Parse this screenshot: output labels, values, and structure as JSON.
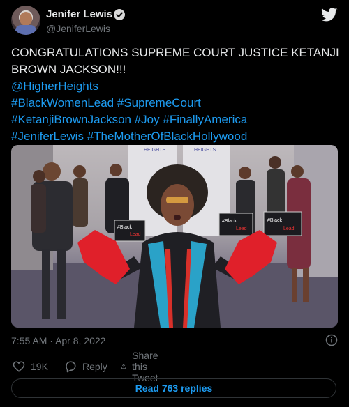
{
  "author": {
    "display_name": "Jenifer Lewis",
    "handle": "@JeniferLewis",
    "verified": true
  },
  "tweet": {
    "lines": [
      [
        {
          "text": "CONGRATULATIONS SUPREME COURT JUSTICE KETANJI",
          "link": false
        }
      ],
      [
        {
          "text": "BROWN JACKSON!!!",
          "link": false
        }
      ],
      [
        {
          "text": "@HigherHeights",
          "link": true
        }
      ],
      [
        {
          "text": "#BlackWomenLead",
          "link": true
        },
        {
          "text": " ",
          "link": false
        },
        {
          "text": "#SupremeCourt",
          "link": true
        }
      ],
      [
        {
          "text": "#KetanjiBrownJackson",
          "link": true
        },
        {
          "text": " ",
          "link": false
        },
        {
          "text": "#Joy",
          "link": true
        },
        {
          "text": " ",
          "link": false
        },
        {
          "text": "#FinallyAmerica",
          "link": true
        }
      ],
      [
        {
          "text": "#JeniferLewis",
          "link": true
        },
        {
          "text": " ",
          "link": false
        },
        {
          "text": "#TheMotherOfBlackHollywood",
          "link": true
        }
      ]
    ]
  },
  "media": {
    "backdrop_text": "HEIGHTS",
    "signs": [
      {
        "line1": "#Black",
        "line2": "Lead"
      },
      {
        "line1": "#Black",
        "line2": "Lead"
      },
      {
        "line1": "#Black",
        "line2": "Lead"
      }
    ]
  },
  "meta": {
    "time": "7:55 AM",
    "separator": "·",
    "date": "Apr 8, 2022"
  },
  "actions": {
    "like_count": "19K",
    "reply_label": "Reply",
    "share_label": "Share this Tweet"
  },
  "read_replies_label": "Read 763 replies",
  "colors": {
    "accent": "#1d9bf0",
    "text": "#e7e9ea",
    "muted": "#71767b",
    "border": "#2f3336",
    "background": "#000000"
  },
  "icons": [
    "verified-badge-icon",
    "twitter-logo-icon",
    "info-icon",
    "heart-icon",
    "reply-icon",
    "share-icon"
  ]
}
